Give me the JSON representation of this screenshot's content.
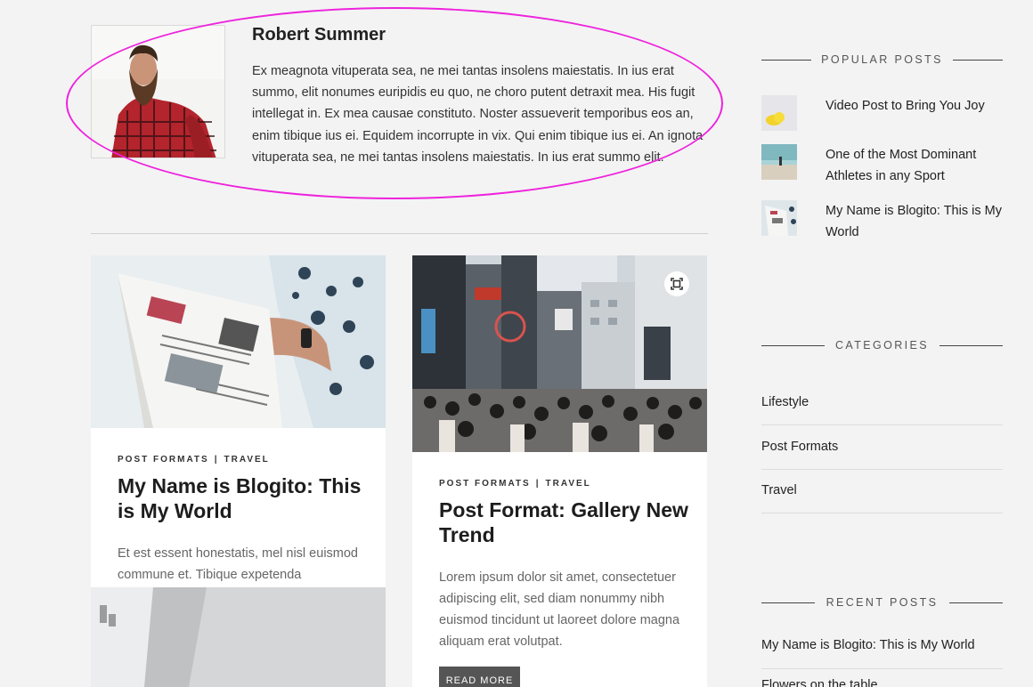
{
  "author": {
    "name": "Robert Summer",
    "bio": "Ex meagnota vituperata sea, ne mei tantas insolens maiestatis. In ius erat summo, elit nonumes euripidis eu quo, ne choro putent detraxit mea. His fugit intellegat in. Ex mea causae constituto. Noster assueverit temporibus eos an, enim tibique ius ei. Equidem incorrupte in vix. Qui enim tibique ius ei. An ignota vituperata sea, ne mei tantas insolens maiestatis. In ius erat summo elit."
  },
  "posts": [
    {
      "categories": [
        "POST FORMATS",
        "TRAVEL"
      ],
      "title": "My Name is Blogito: This is My World",
      "excerpt": "Et est essent honestatis, mel nisl euismod commune et. Tibique expetenda"
    },
    {
      "categories": [
        "POST FORMATS",
        "TRAVEL"
      ],
      "title": "Post Format: Gallery New Trend",
      "excerpt": "Lorem ipsum dolor sit amet, consectetuer adipiscing elit, sed diam nonummy nibh euismod tincidunt ut laoreet dolore magna aliquam erat volutpat.",
      "button": "READ MORE"
    }
  ],
  "sidebar": {
    "popular": {
      "heading": "POPULAR POSTS",
      "items": [
        "Video Post to Bring You Joy",
        "One of the Most Dominant Athletes in any Sport",
        "My Name is Blogito: This is My World"
      ]
    },
    "categories": {
      "heading": "CATEGORIES",
      "items": [
        "Lifestyle",
        "Post Formats",
        "Travel"
      ]
    },
    "recent": {
      "heading": "RECENT POSTS",
      "items": [
        "My Name is Blogito: This is My World",
        "Flowers on the table"
      ]
    }
  },
  "colors": {
    "background": "#f3f3f3",
    "annotation": "#ee22dd",
    "button": "#555555"
  },
  "icons": [
    "gallery-icon"
  ]
}
